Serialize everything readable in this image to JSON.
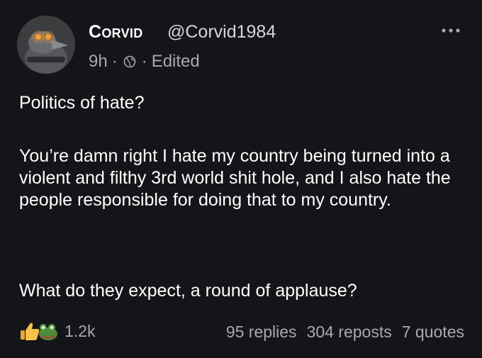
{
  "author": {
    "display_name": "Corvid",
    "handle": "@Corvid1984"
  },
  "meta": {
    "time": "9h",
    "separator": "·",
    "visibility_icon": "globe-icon",
    "edited": "Edited"
  },
  "menu_icon": "more-dots-icon",
  "post": {
    "paragraph_1": "Politics of hate?",
    "paragraph_2": "You’re damn right I hate my country being turned into a violent and filthy 3rd world shit hole, and I also hate the people responsible for doing that to my country.",
    "paragraph_3": "What do they expect, a round of applause?"
  },
  "reactions": {
    "icons": [
      "thumbs-up-emoji",
      "frog-emoji"
    ],
    "count": "1.2k"
  },
  "stats": {
    "replies": "95 replies",
    "reposts": "304 reposts",
    "quotes": "7 quotes"
  },
  "colors": {
    "background": "#141518",
    "text": "#ffffff",
    "muted": "#a9a9ad"
  }
}
